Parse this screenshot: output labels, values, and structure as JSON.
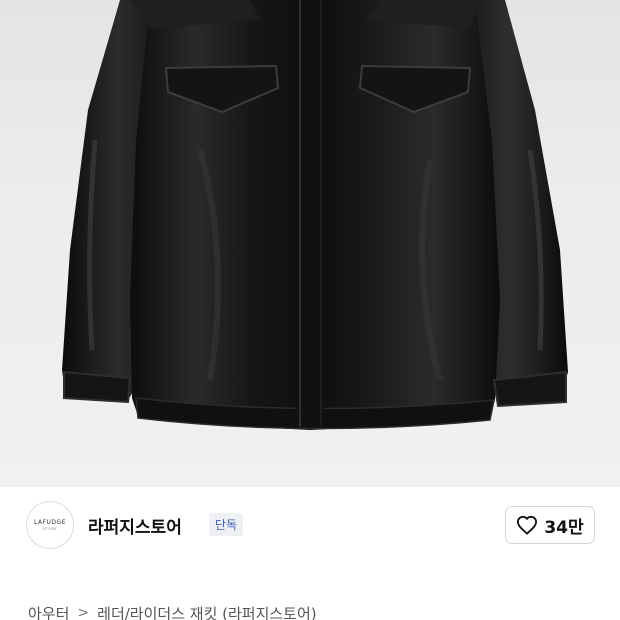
{
  "product_image": {
    "alt": ""
  },
  "store": {
    "logo_text": "LAFUDGE",
    "logo_subtext": "STORE",
    "name": "라퍼지스토어",
    "badge": "단독"
  },
  "like": {
    "icon": "heart-icon",
    "count": "34만"
  },
  "breadcrumb": {
    "items": [
      "아우터",
      "레더/라이더스 재킷 (라퍼지스토어)"
    ],
    "separator": ">"
  },
  "colors": {
    "badge_text": "#3e5eb8",
    "badge_bg": "#eef0f3",
    "jacket": "#151515",
    "background": "#ececec"
  }
}
